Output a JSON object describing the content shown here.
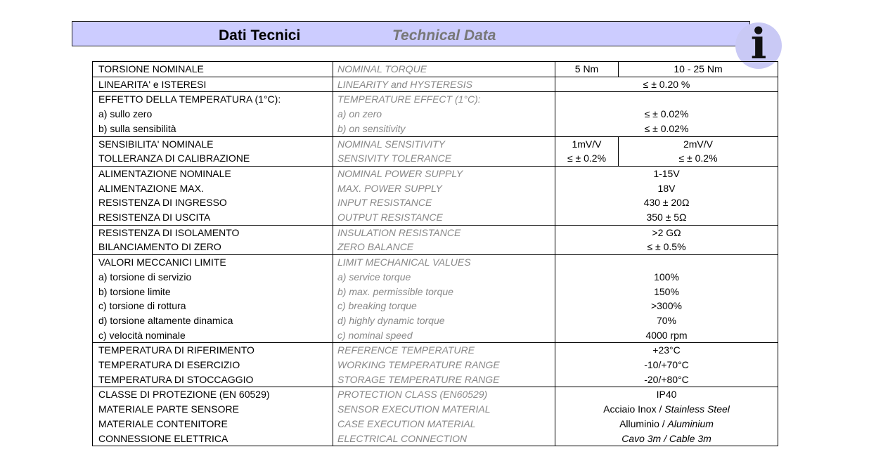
{
  "header": {
    "title_it": "Dati Tecnici",
    "title_en": "Technical Data",
    "info_icon": "i"
  },
  "rows": [
    {
      "it": "TORSIONE NOMINALE",
      "en": "NOMINAL TORQUE",
      "a": "5 Nm",
      "b": "10 - 25 Nm"
    },
    {
      "it": "LINEARITA' e ISTERESI",
      "en": "LINEARITY and HYSTERESIS",
      "v": "≤ ± 0.20 %"
    },
    {
      "it": "EFFETTO DELLA TEMPERATURA (1°C):",
      "en": "TEMPERATURE EFFECT (1°C):",
      "v": ""
    },
    {
      "it": "a) sullo zero",
      "en": "a) on zero",
      "v": "≤ ± 0.02%"
    },
    {
      "it": "b) sulla sensibilità",
      "en": "b) on sensitivity",
      "v": "≤ ± 0.02%"
    },
    {
      "it": "SENSIBILITA' NOMINALE",
      "en": "NOMINAL SENSITIVITY",
      "a": "1mV/V",
      "b": "2mV/V"
    },
    {
      "it": "TOLLERANZA DI CALIBRAZIONE",
      "en": "SENSIVITY TOLERANCE",
      "a": "≤ ± 0.2%",
      "b": "≤ ± 0.2%"
    },
    {
      "it": "ALIMENTAZIONE NOMINALE",
      "en": "NOMINAL POWER SUPPLY",
      "v": "1-15V"
    },
    {
      "it": "ALIMENTAZIONE MAX.",
      "en": "MAX. POWER SUPPLY",
      "v": "18V"
    },
    {
      "it": "RESISTENZA DI INGRESSO",
      "en": "INPUT RESISTANCE",
      "v": "430 ± 20Ω"
    },
    {
      "it": "RESISTENZA DI USCITA",
      "en": "OUTPUT RESISTANCE",
      "v": "350 ± 5Ω"
    },
    {
      "it": "RESISTENZA DI ISOLAMENTO",
      "en": "INSULATION RESISTANCE",
      "v": ">2 GΩ"
    },
    {
      "it": "BILANCIAMENTO DI ZERO",
      "en": "ZERO BALANCE",
      "v": "≤ ± 0.5%"
    },
    {
      "it": "VALORI MECCANICI LIMITE",
      "en": "LIMIT MECHANICAL VALUES",
      "v": ""
    },
    {
      "it": "a) torsione di servizio",
      "en": "a) service torque",
      "v": "100%"
    },
    {
      "it": "b) torsione limite",
      "en": "b) max. permissible torque",
      "v": "150%"
    },
    {
      "it": "c) torsione di rottura",
      "en": "c) breaking torque",
      "v": ">300%"
    },
    {
      "it": "d) torsione altamente dinamica",
      "en": "d) highly dynamic torque",
      "v": "70%"
    },
    {
      "it": "c) velocità nominale",
      "en": "c) nominal speed",
      "v": "4000 rpm"
    },
    {
      "it": "TEMPERATURA DI RIFERIMENTO",
      "en": "REFERENCE TEMPERATURE",
      "v": "+23°C"
    },
    {
      "it": "TEMPERATURA DI ESERCIZIO",
      "en": "WORKING TEMPERATURE RANGE",
      "v": "-10/+70°C"
    },
    {
      "it": "TEMPERATURA DI STOCCAGGIO",
      "en": "STORAGE TEMPERATURE RANGE",
      "v": "-20/+80°C"
    },
    {
      "it": "CLASSE DI PROTEZIONE (EN 60529)",
      "en": "PROTECTION CLASS (EN60529)",
      "v": "IP40"
    },
    {
      "it": "MATERIALE PARTE SENSORE",
      "en": "SENSOR EXECUTION MATERIAL",
      "v1": "Acciaio Inox / ",
      "v2": "Stainless Steel"
    },
    {
      "it": "MATERIALE CONTENITORE",
      "en": "CASE EXECUTION MATERIAL",
      "v1": "Alluminio / ",
      "v2": "Aluminium"
    },
    {
      "it": "CONNESSIONE ELETTRICA",
      "en": "ELECTRICAL CONNECTION",
      "v1": "",
      "v2": "Cavo 3m / Cable 3m"
    }
  ]
}
